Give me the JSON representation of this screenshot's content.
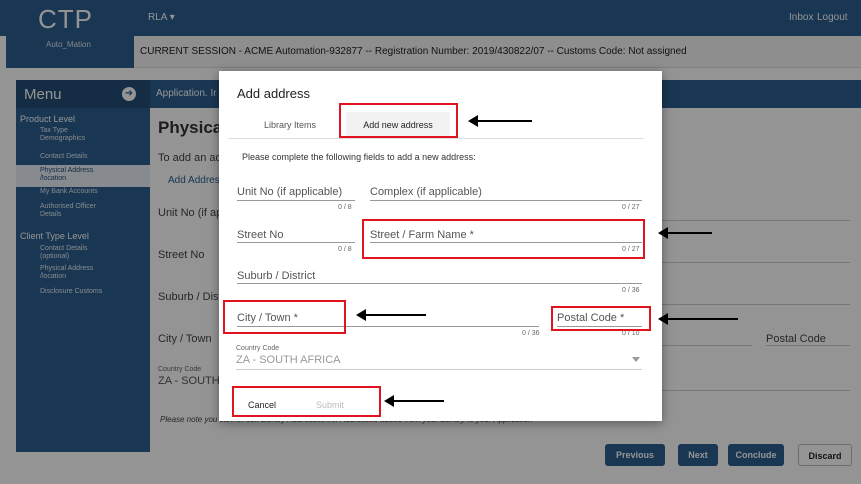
{
  "app": {
    "logo": "CTP",
    "logo_sub": "Auto_Mation",
    "user_menu": "RLA",
    "inbox": "Inbox",
    "logout": "Logout",
    "session": "CURRENT SESSION - ACME Automation-932877 -- Registration Number: 2019/430822/07 -- Customs Code: Not assigned"
  },
  "sidebar": {
    "title": "Menu",
    "product_level": "Product Level",
    "items_product": [
      "Tax Type Demographics",
      "Contact Details",
      "Physical Address /location",
      "My Bank Accounts",
      "Authorised Officer Details"
    ],
    "client_type_level": "Client Type Level",
    "items_client": [
      "Contact Details (optional)",
      "Physical Address /location",
      "Disclosure Customs"
    ]
  },
  "background": {
    "breadcrumb": "Application. Ir",
    "page_heading": "Physical",
    "to_add": "To add an ad",
    "add_address": "Add Address",
    "unit_no": "Unit No (if ap",
    "street_no": "Street No",
    "suburb": "Suburb / Distr",
    "city": "City / Town",
    "postal_code": "Postal Code",
    "country_code_label": "Country Code",
    "country_value": "ZA - SOUTH",
    "note": "Please note  you cannot edit Library Addresses i.e. Addresses added from your Library to your Application",
    "buttons": {
      "previous": "Previous",
      "next": "Next",
      "conclude": "Conclude",
      "discard": "Discard"
    }
  },
  "modal": {
    "title": "Add address",
    "tabs": [
      "Library Items",
      "Add new address"
    ],
    "intro": "Please complete the following fields to add a new address:",
    "fields": {
      "unit_no": {
        "label": "Unit No (if applicable)",
        "counter": "0 / 8"
      },
      "complex": {
        "label": "Complex (if applicable)",
        "counter": "0 / 27"
      },
      "street_no": {
        "label": "Street No",
        "counter": "0 / 8"
      },
      "street_name": {
        "label": "Street / Farm Name *",
        "counter": "0 / 27"
      },
      "suburb": {
        "label": "Suburb / District",
        "counter": "0 / 36"
      },
      "city": {
        "label": "City / Town *",
        "counter": "0 / 36"
      },
      "postal_code": {
        "label": "Postal Code *",
        "counter": "0 / 10"
      }
    },
    "country_code_label": "Country Code",
    "country_value": "ZA - SOUTH AFRICA",
    "cancel": "Cancel",
    "submit": "Submit"
  },
  "colors": {
    "brand": "#2b5f8f",
    "highlight": "#e0141e"
  }
}
